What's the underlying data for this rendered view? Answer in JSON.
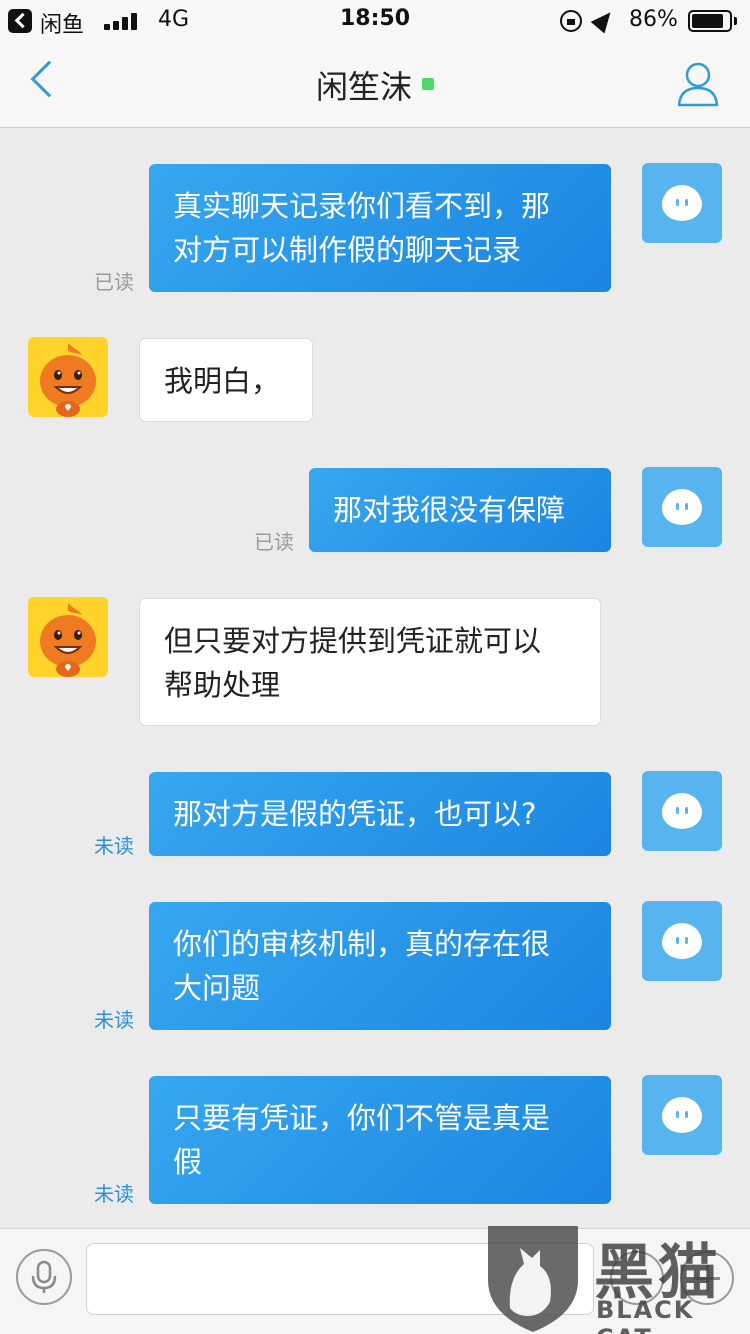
{
  "status_bar": {
    "app_name": "闲鱼",
    "network": "4G",
    "time": "18:50",
    "battery": "86%",
    "battery_level": 0.86
  },
  "nav": {
    "title": "闲笙沫",
    "online_color": "#4cd964"
  },
  "messages": [
    {
      "side": "out",
      "text_lines": [
        "真实聊天记录你们看不到，那",
        "对方可以制作假的聊天记录"
      ],
      "status": "已读"
    },
    {
      "side": "in",
      "text_lines": [
        "我明白，"
      ]
    },
    {
      "side": "out",
      "text_lines": [
        "那对我很没有保障"
      ],
      "status": "已读"
    },
    {
      "side": "in",
      "text_lines": [
        "但只要对方提供到凭证就可以",
        "帮助处理"
      ]
    },
    {
      "side": "out",
      "text_lines": [
        "那对方是假的凭证，也可以?"
      ],
      "status": "未读"
    },
    {
      "side": "out",
      "text_lines": [
        "你们的审核机制，真的存在很",
        "大问题"
      ],
      "status": "未读"
    },
    {
      "side": "out",
      "text_lines": [
        "只要有凭证，你们不管是真是",
        "假"
      ],
      "status": "未读"
    }
  ],
  "input": {
    "placeholder": ""
  },
  "watermark": {
    "cn": "黑猫",
    "en": "BLACK CAT"
  },
  "colors": {
    "accent": "#2f9bd7",
    "out_bubble": "#2a97e8",
    "unread": "#2f8fd4"
  }
}
